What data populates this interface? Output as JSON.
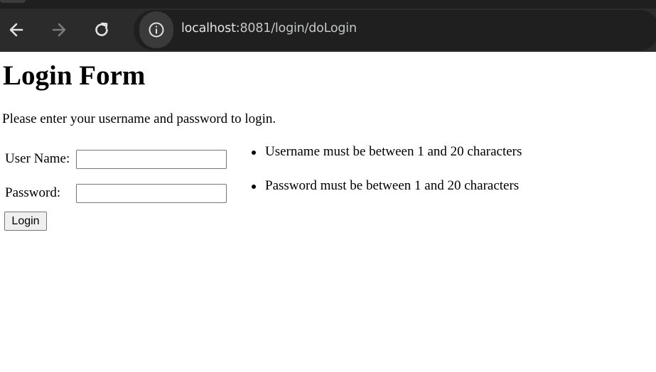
{
  "browser": {
    "back_icon": "arrow-left-icon",
    "forward_icon": "arrow-right-icon",
    "reload_icon": "reload-icon",
    "site_info_icon": "info-icon",
    "url_host": "localhost",
    "url_rest": ":8081/login/doLogin"
  },
  "page": {
    "title": "Login Form",
    "intro": "Please enter your username and password to login."
  },
  "form": {
    "username_label": "User Name:",
    "username_value": "",
    "password_label": "Password:",
    "password_value": "",
    "submit_label": "Login"
  },
  "errors": [
    "Username must be between 1 and 20 characters",
    "Password must be between 1 and 20 characters"
  ]
}
